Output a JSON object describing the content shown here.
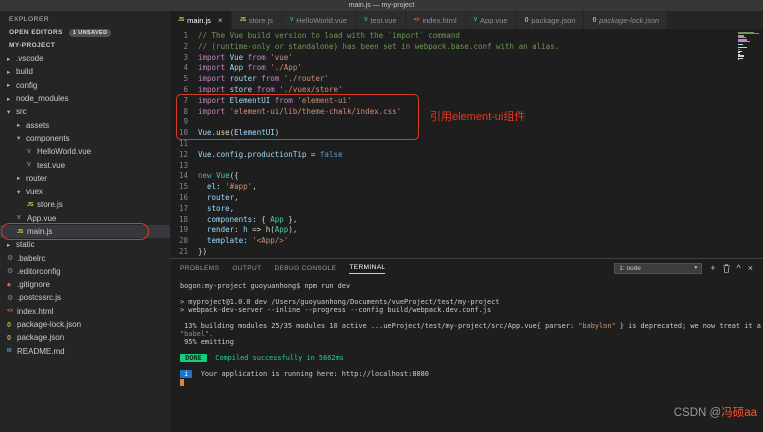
{
  "title_bar": {
    "title": "main.js — my-project"
  },
  "sidebar": {
    "header": "EXPLORER",
    "open_editors_label": "OPEN EDITORS",
    "open_editors_badge": "1 UNSAVED",
    "project_label": "MY-PROJECT",
    "items": [
      {
        "label": ".vscode",
        "indent": 0,
        "type": "folder",
        "expanded": false
      },
      {
        "label": "build",
        "indent": 0,
        "type": "folder",
        "expanded": false
      },
      {
        "label": "config",
        "indent": 0,
        "type": "folder",
        "expanded": false
      },
      {
        "label": "node_modules",
        "indent": 0,
        "type": "folder",
        "expanded": false
      },
      {
        "label": "src",
        "indent": 0,
        "type": "folder",
        "expanded": true
      },
      {
        "label": "assets",
        "indent": 1,
        "type": "folder",
        "expanded": false
      },
      {
        "label": "components",
        "indent": 1,
        "type": "folder",
        "expanded": true
      },
      {
        "label": "HelloWorld.vue",
        "indent": 2,
        "type": "vue"
      },
      {
        "label": "test.vue",
        "indent": 2,
        "type": "vue"
      },
      {
        "label": "router",
        "indent": 1,
        "type": "folder",
        "expanded": false
      },
      {
        "label": "vuex",
        "indent": 1,
        "type": "folder",
        "expanded": true
      },
      {
        "label": "store.js",
        "indent": 2,
        "type": "js"
      },
      {
        "label": "App.vue",
        "indent": 1,
        "type": "vue"
      },
      {
        "label": "main.js",
        "indent": 1,
        "type": "js",
        "selected": true
      },
      {
        "label": "static",
        "indent": 0,
        "type": "folder",
        "expanded": false
      },
      {
        "label": ".babelrc",
        "indent": 0,
        "type": "config"
      },
      {
        "label": ".editorconfig",
        "indent": 0,
        "type": "config"
      },
      {
        "label": ".gitignore",
        "indent": 0,
        "type": "git"
      },
      {
        "label": ".postcssrc.js",
        "indent": 0,
        "type": "config"
      },
      {
        "label": "index.html",
        "indent": 0,
        "type": "html"
      },
      {
        "label": "package-lock.json",
        "indent": 0,
        "type": "json"
      },
      {
        "label": "package.json",
        "indent": 0,
        "type": "json"
      },
      {
        "label": "README.md",
        "indent": 0,
        "type": "md"
      }
    ]
  },
  "tabs": [
    {
      "label": "main.js",
      "icon": "js",
      "active": true
    },
    {
      "label": "store.js",
      "icon": "js"
    },
    {
      "label": "HelloWorld.vue",
      "icon": "vue"
    },
    {
      "label": "test.vue",
      "icon": "vue"
    },
    {
      "label": "index.html",
      "icon": "html"
    },
    {
      "label": "App.vue",
      "icon": "vue"
    },
    {
      "label": "package.json",
      "icon": "json"
    },
    {
      "label": "package-lock.json",
      "icon": "json",
      "italic": true
    }
  ],
  "editor": {
    "note": "引用element-ui组件",
    "lines": [
      [
        [
          "c",
          "// The Vue build version to load with the `import` command"
        ]
      ],
      [
        [
          "c",
          "// (runtime-only or standalone) has been set in webpack.base.conf with an alias."
        ]
      ],
      [
        [
          "k",
          "import "
        ],
        [
          "v",
          "Vue"
        ],
        [
          "k",
          " from "
        ],
        [
          "s",
          "'vue'"
        ]
      ],
      [
        [
          "k",
          "import "
        ],
        [
          "v",
          "App"
        ],
        [
          "k",
          " from "
        ],
        [
          "s",
          "'./App'"
        ]
      ],
      [
        [
          "k",
          "import "
        ],
        [
          "v",
          "router"
        ],
        [
          "k",
          " from "
        ],
        [
          "s",
          "'./router'"
        ]
      ],
      [
        [
          "k",
          "import "
        ],
        [
          "v",
          "store"
        ],
        [
          "k",
          " from "
        ],
        [
          "s",
          "'./vuex/store'"
        ]
      ],
      [
        [
          "k",
          "import "
        ],
        [
          "v",
          "ElementUI"
        ],
        [
          "k",
          " from "
        ],
        [
          "s",
          "'element-ui'"
        ]
      ],
      [
        [
          "k",
          "import "
        ],
        [
          "s",
          "'element-ui/lib/theme-chalk/index.css'"
        ]
      ],
      [],
      [
        [
          "v",
          "Vue"
        ],
        [
          "p",
          "."
        ],
        [
          "f",
          "use"
        ],
        [
          "p",
          "("
        ],
        [
          "v",
          "ElementUI"
        ],
        [
          "p",
          ")"
        ]
      ],
      [],
      [
        [
          "v",
          "Vue"
        ],
        [
          "p",
          "."
        ],
        [
          "v",
          "config"
        ],
        [
          "p",
          "."
        ],
        [
          "v",
          "productionTip"
        ],
        [
          "p",
          " = "
        ],
        [
          "b",
          "false"
        ]
      ],
      [],
      [
        [
          "b",
          "new "
        ],
        [
          "t",
          "Vue"
        ],
        [
          "p",
          "({"
        ]
      ],
      [
        [
          "p",
          "  "
        ],
        [
          "v",
          "el"
        ],
        [
          "p",
          ": "
        ],
        [
          "s",
          "'#app'"
        ],
        [
          "p",
          ","
        ]
      ],
      [
        [
          "p",
          "  "
        ],
        [
          "v",
          "router"
        ],
        [
          "p",
          ","
        ]
      ],
      [
        [
          "p",
          "  "
        ],
        [
          "v",
          "store"
        ],
        [
          "p",
          ","
        ]
      ],
      [
        [
          "p",
          "  "
        ],
        [
          "v",
          "components"
        ],
        [
          "p",
          ": { "
        ],
        [
          "t",
          "App"
        ],
        [
          "p",
          " },"
        ]
      ],
      [
        [
          "p",
          "  "
        ],
        [
          "v",
          "render"
        ],
        [
          "p",
          ": "
        ],
        [
          "v",
          "h"
        ],
        [
          "p",
          " => "
        ],
        [
          "f",
          "h"
        ],
        [
          "p",
          "("
        ],
        [
          "t",
          "App"
        ],
        [
          "p",
          "),"
        ]
      ],
      [
        [
          "p",
          "  "
        ],
        [
          "v",
          "template"
        ],
        [
          "p",
          ": "
        ],
        [
          "s",
          "'<App/>'"
        ]
      ],
      [
        [
          "p",
          "})"
        ]
      ]
    ]
  },
  "panel": {
    "tabs": [
      {
        "label": "PROBLEMS"
      },
      {
        "label": "OUTPUT"
      },
      {
        "label": "DEBUG CONSOLE"
      },
      {
        "label": "TERMINAL",
        "active": true
      }
    ],
    "select_value": "1: node",
    "select_icon": "chevron-down-icon",
    "actions": [
      "plus-icon",
      "trash-icon",
      "chevron-up-icon",
      "close-icon"
    ],
    "terminal_lines": [
      [
        [
          "",
          "bogon:my-project guoyuanhong$ npm run dev"
        ]
      ],
      [],
      [
        [
          "",
          "> myproject@1.0.0 dev /Users/guoyuanhong/Documents/vueProject/test/my-project"
        ]
      ],
      [
        [
          "",
          "> webpack-dev-server --inline --progress --config build/webpack.dev.conf.js"
        ]
      ],
      [],
      [
        [
          "",
          " 13% building modules 25/35 modules 10 active ...ueProject/test/my-project/src/App.vue"
        ],
        [
          "",
          "{ parser: "
        ],
        [
          "orange",
          "\"babylon\""
        ],
        [
          "",
          " }"
        ],
        [
          "",
          " is deprecated; we now treat it a"
        ]
      ],
      [
        [
          "dim",
          "\"babel\"."
        ]
      ],
      [
        [
          "",
          " 95% emitting"
        ]
      ],
      [],
      [
        [
          "badge-green",
          " DONE "
        ],
        [
          "green",
          "  Compiled successfully in 5662ms"
        ]
      ],
      [],
      [
        [
          "badge-blue",
          " i "
        ],
        [
          "",
          "  Your application is running here: http://localhost:8080"
        ]
      ],
      [
        [
          "cursor",
          ""
        ]
      ]
    ]
  },
  "watermark": {
    "prefix": "CSDN @",
    "name": "冯硕aa"
  }
}
